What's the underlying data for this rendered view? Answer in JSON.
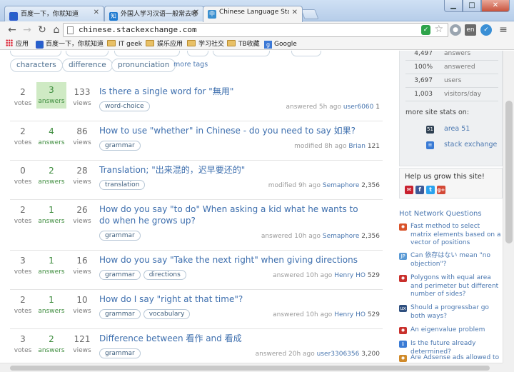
{
  "browser": {
    "tabs": [
      {
        "title": "百度一下，你就知道",
        "icon": "baidu-paw",
        "color": "#2d5ccc",
        "glyph": "🐾"
      },
      {
        "title": "外国人学习汉语一般常去哪",
        "icon": "zhihu",
        "color": "#1e7ad1",
        "glyph": "知"
      },
      {
        "title": "Chinese Language Stack Exchange",
        "icon": "stackexchange",
        "color": "#3a8fcf",
        "glyph": "中"
      }
    ],
    "url": "chinese.stackexchange.com",
    "window_buttons": {
      "minimize": "▁",
      "maximize": "□",
      "close": "✕"
    },
    "bookmarks": [
      {
        "label": "应用",
        "icon": "apps-grid"
      },
      {
        "label": "百度一下，你就知道",
        "icon": "baidu-paw"
      },
      {
        "label": "IT geek",
        "icon": "folder"
      },
      {
        "label": "娱乐应用",
        "icon": "folder"
      },
      {
        "label": "学习社交",
        "icon": "folder"
      },
      {
        "label": "TB收藏",
        "icon": "folder"
      },
      {
        "label": "Google",
        "icon": "google"
      }
    ]
  },
  "tag_cloud": {
    "tags": [
      "characters",
      "difference",
      "pronunciation"
    ],
    "more_label": "more tags"
  },
  "questions": [
    {
      "votes": "2",
      "votes_label": "votes",
      "answers": "3",
      "answers_label": "answers",
      "accepted": true,
      "views": "133",
      "views_label": "views",
      "title": "Is there a single word for \"無用\"",
      "tags": [
        "word-choice"
      ],
      "action": "answered 5h ago",
      "user": "user6060",
      "rep": "1"
    },
    {
      "votes": "2",
      "votes_label": "votes",
      "answers": "4",
      "answers_label": "answers",
      "accepted": false,
      "views": "86",
      "views_label": "views",
      "title": "How to use \"whether\" in Chinese - do you need to say 如果?",
      "tags": [
        "grammar"
      ],
      "action": "modified 8h ago",
      "user": "Brian",
      "rep": "121"
    },
    {
      "votes": "0",
      "votes_label": "votes",
      "answers": "2",
      "answers_label": "answers",
      "accepted": false,
      "views": "28",
      "views_label": "views",
      "title": "Translation; \"出来混的，迟早要还的\"",
      "tags": [
        "translation"
      ],
      "action": "modified 9h ago",
      "user": "Semaphore",
      "rep": "2,356"
    },
    {
      "votes": "2",
      "votes_label": "votes",
      "answers": "1",
      "answers_label": "answers",
      "accepted": false,
      "views": "26",
      "views_label": "views",
      "title": "How do you say \"to do\" When asking a kid what he wants to do when he grows up?",
      "tags": [
        "grammar"
      ],
      "action": "answered 10h ago",
      "user": "Semaphore",
      "rep": "2,356"
    },
    {
      "votes": "3",
      "votes_label": "votes",
      "answers": "1",
      "answers_label": "answers",
      "accepted": false,
      "views": "16",
      "views_label": "views",
      "title": "How do you say \"Take the next right\" when giving directions",
      "tags": [
        "grammar",
        "directions"
      ],
      "action": "answered 10h ago",
      "user": "Henry HO",
      "rep": "529"
    },
    {
      "votes": "2",
      "votes_label": "votes",
      "answers": "1",
      "answers_label": "answers",
      "accepted": false,
      "views": "10",
      "views_label": "views",
      "title": "How do I say \"right at that time\"?",
      "tags": [
        "grammar",
        "vocabulary"
      ],
      "action": "answered 10h ago",
      "user": "Henry HO",
      "rep": "529"
    },
    {
      "votes": "3",
      "votes_label": "votes",
      "answers": "2",
      "answers_label": "answers",
      "accepted": false,
      "views": "121",
      "views_label": "views",
      "title": "Difference between 看作 and 看成",
      "tags": [
        "grammar"
      ],
      "action": "answered 20h ago",
      "user": "user3306356",
      "rep": "3,200"
    }
  ],
  "sidebar": {
    "stats": [
      {
        "value": "4,497",
        "label": "answers"
      },
      {
        "value": "100%",
        "label": "answered"
      },
      {
        "value": "3,697",
        "label": "users"
      },
      {
        "value": "1,003",
        "label": "visitors/day"
      }
    ],
    "more_stats_label": "more site stats on:",
    "site_links": [
      {
        "label": "area 51",
        "icon": "area51-icon",
        "glyph": "51",
        "color": "#2c3e50"
      },
      {
        "label": "stack exchange",
        "icon": "stackexchange-icon",
        "glyph": "≡",
        "color": "#3a7bd5"
      }
    ],
    "grow_title": "Help us grow this site!",
    "share_icons": [
      {
        "name": "email-share-icon",
        "glyph": "✉",
        "color": "#c8202e"
      },
      {
        "name": "facebook-share-icon",
        "glyph": "f",
        "color": "#3b5998"
      },
      {
        "name": "twitter-share-icon",
        "glyph": "t",
        "color": "#2aa3ef"
      },
      {
        "name": "googleplus-share-icon",
        "glyph": "g+",
        "color": "#d34836"
      }
    ],
    "hnq_title": "Hot Network Questions",
    "hnq": [
      {
        "text": "Fast method to select matrix elements based on a vector of positions",
        "site": "mathematica",
        "glyph": "✹",
        "color": "#d9532a"
      },
      {
        "text": "Can 依存はない mean \"no objection\"?",
        "site": "japanese",
        "glyph": "JP",
        "color": "#5a9ad5"
      },
      {
        "text": "Polygons with equal area and perimeter but different number of sides?",
        "site": "math",
        "glyph": "✹",
        "color": "#c9302c"
      },
      {
        "text": "Should a progressbar go both ways?",
        "site": "ux",
        "glyph": "ux",
        "color": "#2f4f7f"
      },
      {
        "text": "An eigenvalue problem",
        "site": "mathoverflow",
        "glyph": "✹",
        "color": "#c9302c"
      },
      {
        "text": "Is the future already determined?",
        "site": "philosophy",
        "glyph": "ℹ",
        "color": "#3a7bd5"
      },
      {
        "text": "Are Adsense ads allowed to run",
        "site": "webmasters",
        "glyph": "✹",
        "color": "#d08a2a"
      }
    ]
  }
}
